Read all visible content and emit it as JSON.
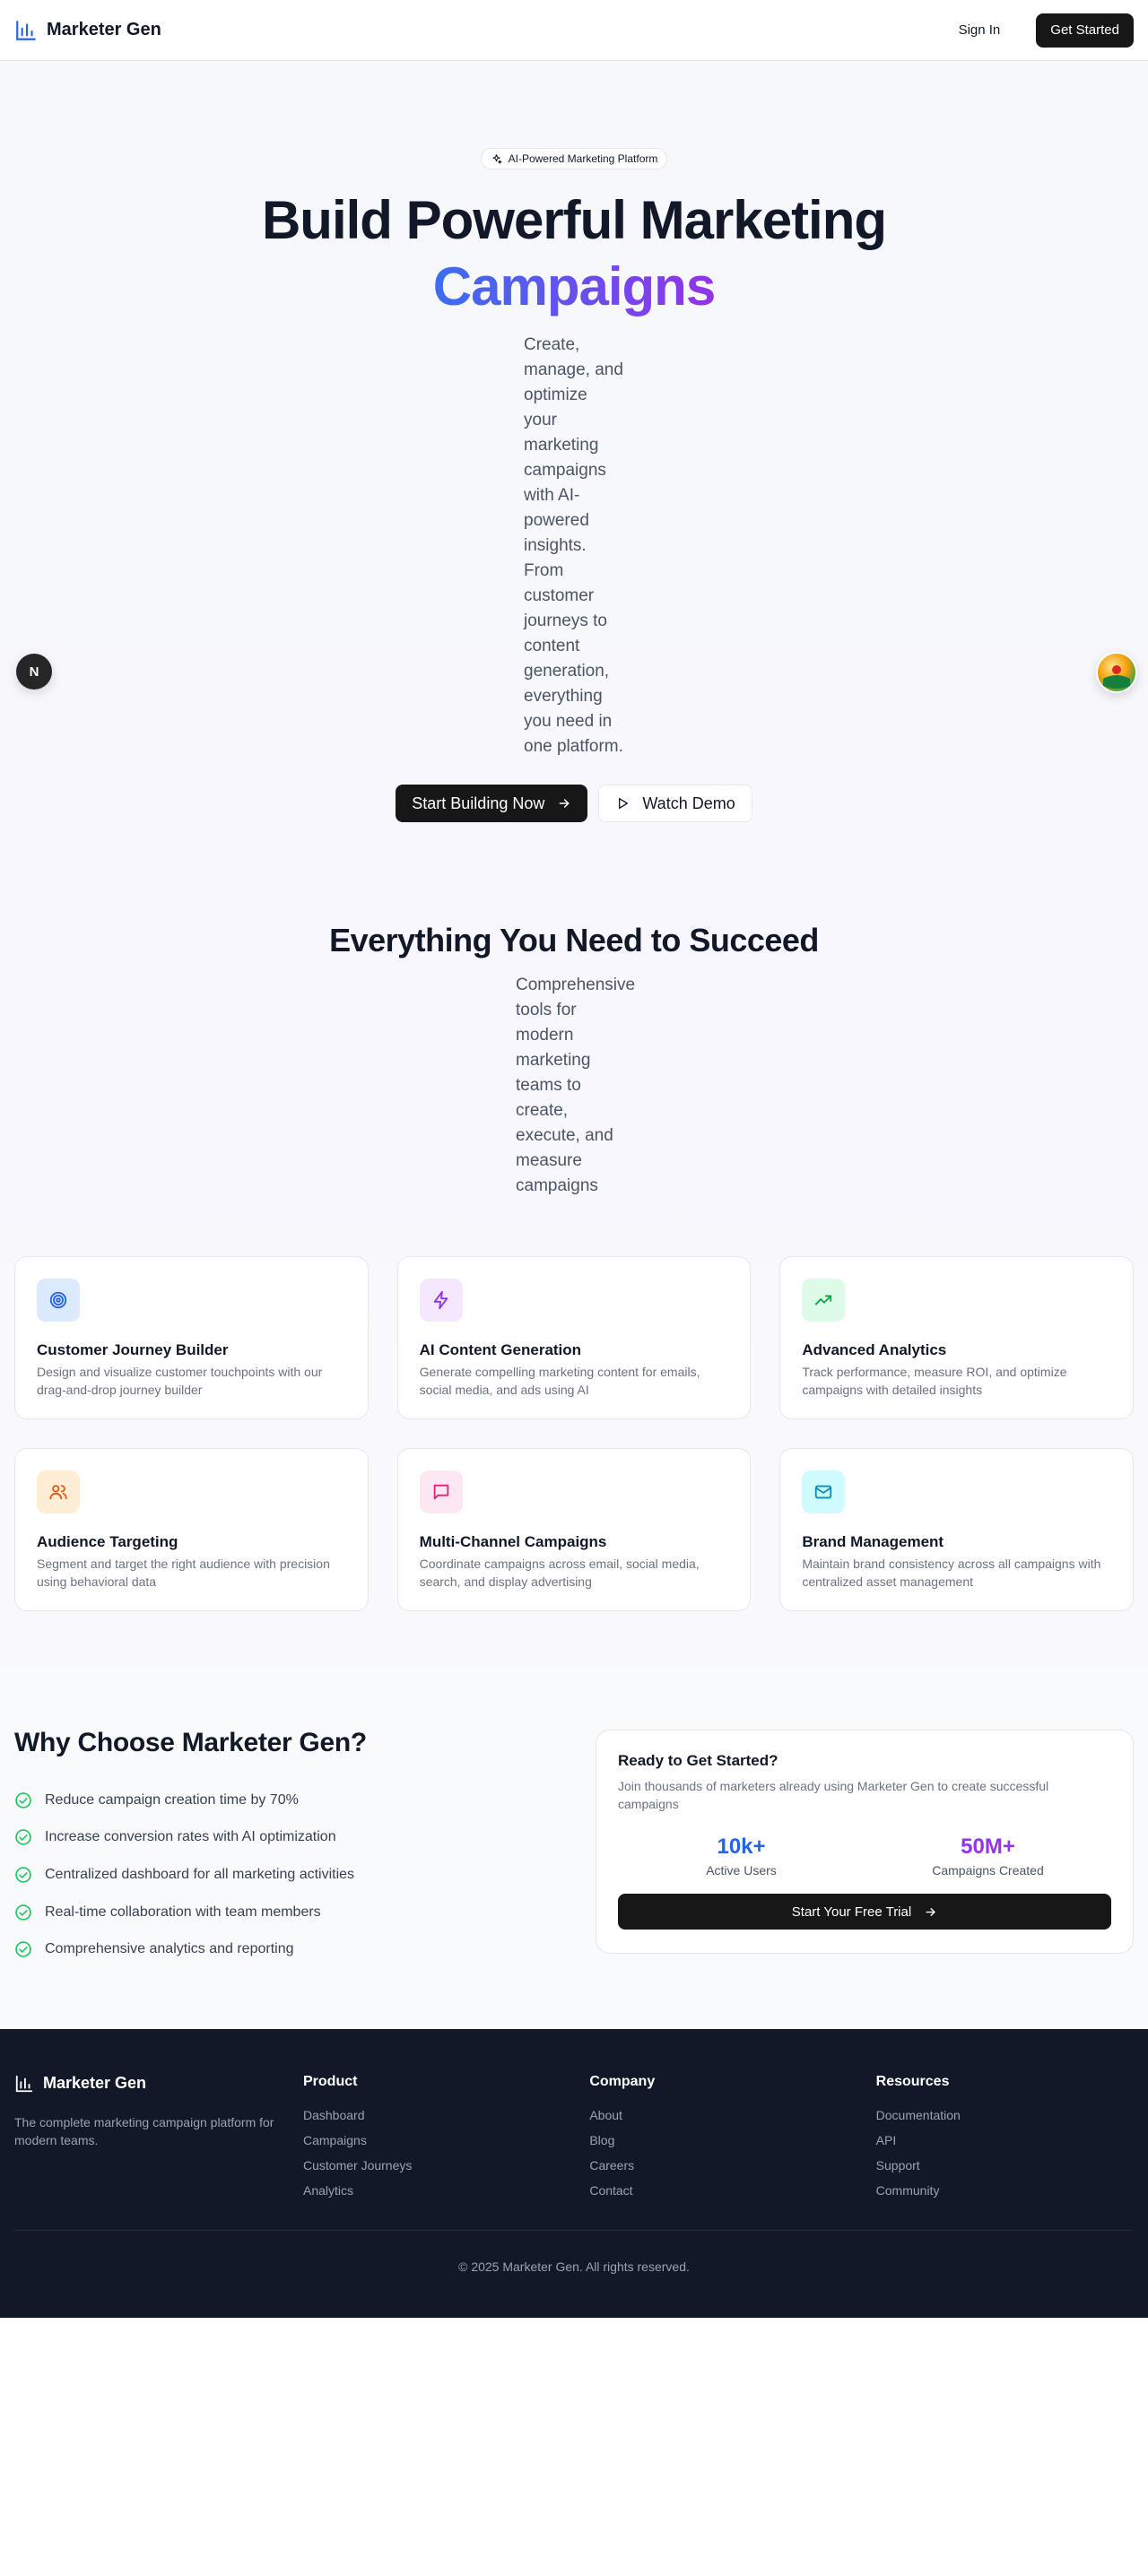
{
  "nav": {
    "brand": "Marketer Gen",
    "sign_in": "Sign In",
    "get_started": "Get Started"
  },
  "hero": {
    "badge": "AI-Powered Marketing Platform",
    "title_line1": "Build Powerful Marketing",
    "title_line2": "Campaigns",
    "description": "Create, manage, and optimize your marketing campaigns with AI-powered insights. From customer journeys to content generation, everything you need in one platform.",
    "primary_cta": "Start Building Now",
    "secondary_cta": "Watch Demo",
    "side_badge": "N"
  },
  "features": {
    "title": "Everything You Need to Succeed",
    "description": "Comprehensive tools for modern marketing teams to create, execute, and measure campaigns",
    "cards": [
      {
        "title": "Customer Journey Builder",
        "desc": "Design and visualize customer touchpoints with our drag-and-drop journey builder",
        "icon": "target-icon",
        "bg": "#dbeafe",
        "color": "#2563eb"
      },
      {
        "title": "AI Content Generation",
        "desc": "Generate compelling marketing content for emails, social media, and ads using AI",
        "icon": "lightning-icon",
        "bg": "#f3e8ff",
        "color": "#9333ea"
      },
      {
        "title": "Advanced Analytics",
        "desc": "Track performance, measure ROI, and optimize campaigns with detailed insights",
        "icon": "trending-up-icon",
        "bg": "#dcfce7",
        "color": "#16a34a"
      },
      {
        "title": "Audience Targeting",
        "desc": "Segment and target the right audience with precision using behavioral data",
        "icon": "users-icon",
        "bg": "#ffedd5",
        "color": "#ea580c"
      },
      {
        "title": "Multi-Channel Campaigns",
        "desc": "Coordinate campaigns across email, social media, search, and display advertising",
        "icon": "message-icon",
        "bg": "#fce7f3",
        "color": "#db2777"
      },
      {
        "title": "Brand Management",
        "desc": "Maintain brand consistency across all campaigns with centralized asset management",
        "icon": "mail-icon",
        "bg": "#cffafe",
        "color": "#0891b2"
      }
    ]
  },
  "why": {
    "title": "Why Choose Marketer Gen?",
    "items": [
      "Reduce campaign creation time by 70%",
      "Increase conversion rates with AI optimization",
      "Centralized dashboard for all marketing activities",
      "Real-time collaboration with team members",
      "Comprehensive analytics and reporting"
    ],
    "cta_title": "Ready to Get Started?",
    "cta_desc": "Join thousands of marketers already using Marketer Gen to create successful campaigns",
    "stats": [
      {
        "value": "10k+",
        "label": "Active Users",
        "color": "#2563eb"
      },
      {
        "value": "50M+",
        "label": "Campaigns Created",
        "color": "#9333ea"
      }
    ],
    "cta_button": "Start Your Free Trial"
  },
  "footer": {
    "brand": "Marketer Gen",
    "desc": "The complete marketing campaign platform for modern teams.",
    "columns": [
      {
        "title": "Product",
        "links": [
          "Dashboard",
          "Campaigns",
          "Customer Journeys",
          "Analytics"
        ]
      },
      {
        "title": "Company",
        "links": [
          "About",
          "Blog",
          "Careers",
          "Contact"
        ]
      },
      {
        "title": "Resources",
        "links": [
          "Documentation",
          "API",
          "Support",
          "Community"
        ]
      }
    ],
    "copyright": "© 2025 Marketer Gen. All rights reserved."
  }
}
